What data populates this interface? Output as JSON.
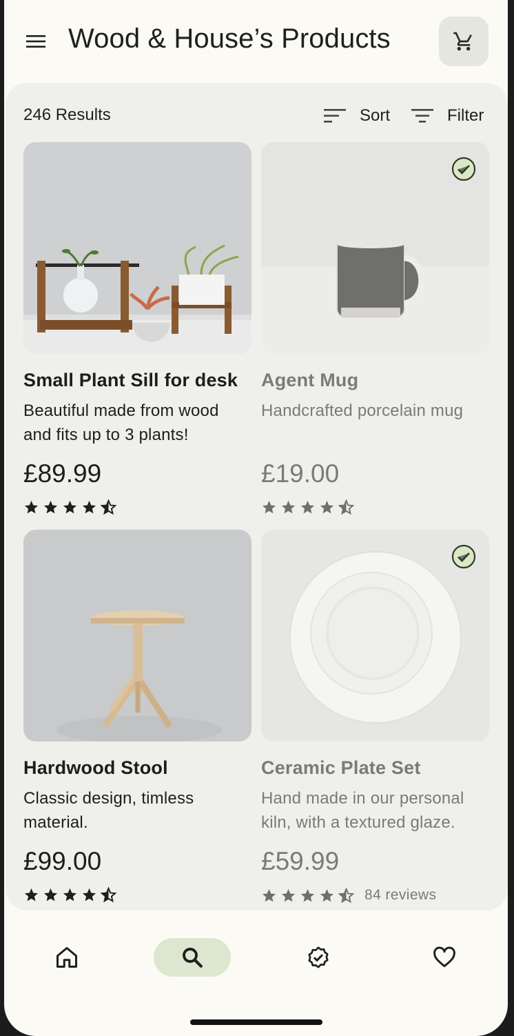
{
  "header": {
    "title": "Wood & House’s Products",
    "menu_icon": "menu-icon",
    "cart_icon": "cart-icon"
  },
  "toolbar": {
    "results": "246 Results",
    "sort_label": "Sort",
    "filter_label": "Filter"
  },
  "products": [
    {
      "name": "Small Plant Sill for desk",
      "description": "Beautiful made from wood and fits up to 3 plants!",
      "price": "£89.99",
      "rating": 4.5,
      "selected": false,
      "image": "plant-sill-image"
    },
    {
      "name": "Agent Mug",
      "description": "Handcrafted porcelain mug",
      "price": "£19.00",
      "rating": 4.5,
      "selected": true,
      "image": "mug-image"
    },
    {
      "name": "Hardwood Stool",
      "description": "Classic design, timless material.",
      "price": "£99.00",
      "rating": 4.5,
      "selected": false,
      "image": "stool-image"
    },
    {
      "name": "Ceramic Plate Set",
      "description": "Hand made in our personal kiln, with a textured glaze.",
      "price": "£59.99",
      "rating": 4.5,
      "reviews": "84 reviews",
      "selected": true,
      "image": "plates-image"
    }
  ],
  "nav": {
    "items": [
      "home-icon",
      "search-icon",
      "verified-icon",
      "heart-icon"
    ],
    "active": "search-icon"
  },
  "colors": {
    "background": "#fcfaf5",
    "sheet": "#efefeb",
    "accent": "#dde6cf",
    "check_fill": "#dbe8c6",
    "check_stroke": "#3d5a1f"
  }
}
